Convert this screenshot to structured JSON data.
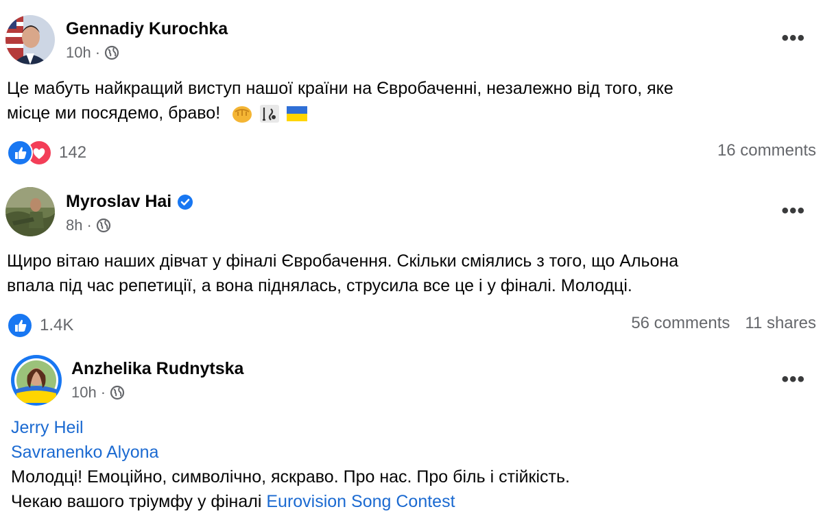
{
  "posts": [
    {
      "author": "Gennadiy Kurochka",
      "time": "10h",
      "separator": "·",
      "verified": false,
      "text_lines": [
        "Це мабуть найкращий виступ нашої країни на  Євробаченні, незалежно від того, яке",
        "місце ми посядемо, браво!"
      ],
      "reaction_count": "142",
      "comments": "16 comments",
      "shares": "",
      "reactions": [
        "like-icon",
        "love-icon"
      ],
      "emojis": [
        "fist-emoji",
        "music-note-emoji",
        "ukraine-flag-emoji"
      ]
    },
    {
      "author": "Myroslav Hai",
      "time": "8h",
      "separator": "·",
      "verified": true,
      "text_lines": [
        "Щиро вітаю наших дівчат у фіналі Євробачення. Скільки сміялись з того, що Альона",
        "впала під час репетиції, а вона піднялась, струсила все це і у фіналі. Молодці."
      ],
      "reaction_count": "1.4K",
      "comments": "56 comments",
      "shares": "11 shares",
      "reactions": [
        "like-icon"
      ]
    },
    {
      "author": "Anzhelika Rudnytska",
      "time": "10h",
      "separator": "·",
      "verified": false,
      "mentions": [
        "Jerry Heil",
        "Savranenko Alyona"
      ],
      "text_line_1": "Молодці! Емоційно, символічно, яскраво. Про нас. Про біль і стійкість.",
      "text_line_2_prefix": "Чекаю вашого тріумфу у фіналі ",
      "text_line_2_link": "Eurovision Song Contest"
    }
  ],
  "colors": {
    "link": "#1b6ad1",
    "meta": "#65676b",
    "like_blue": "#1877f2",
    "love_red": "#f33e58"
  }
}
